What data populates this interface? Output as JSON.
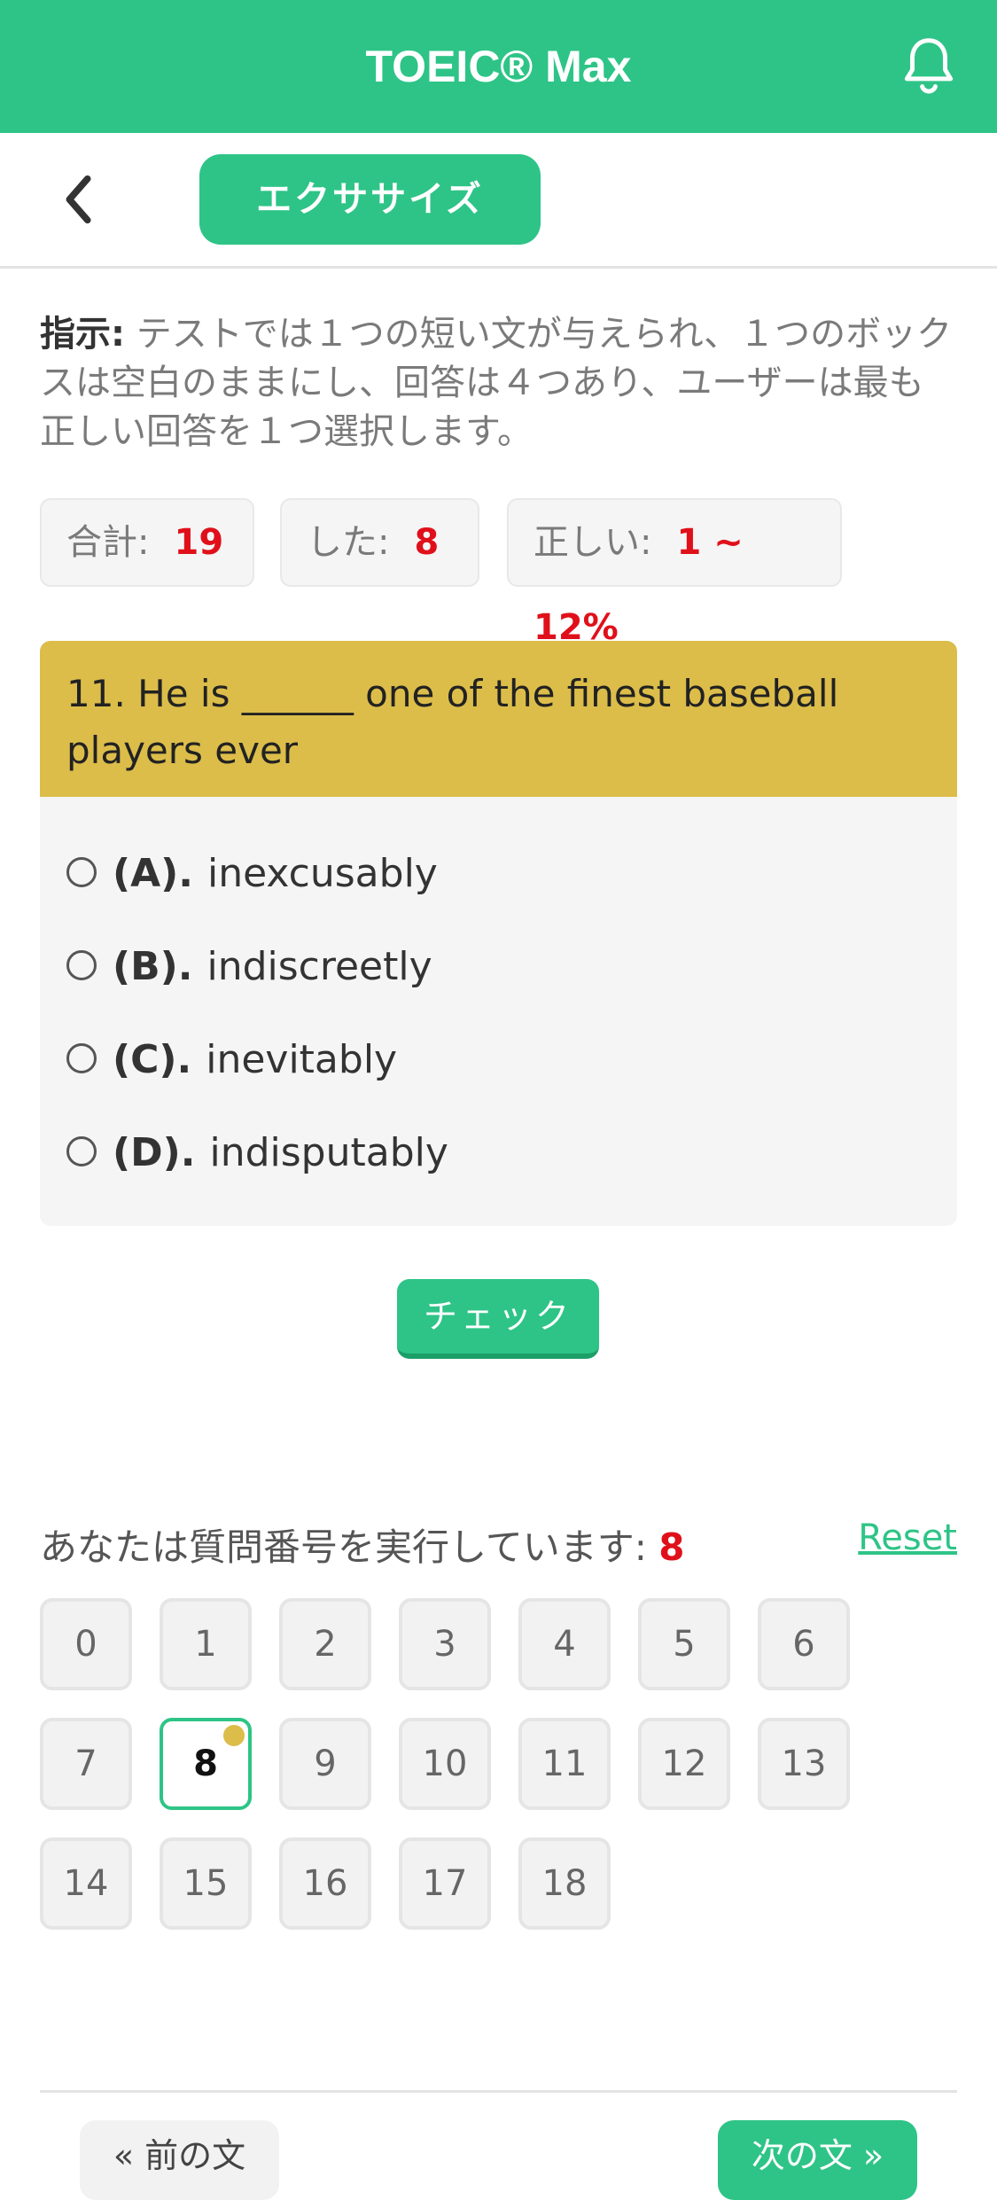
{
  "app": {
    "title": "TOEIC® Max",
    "bell_icon": "bell-icon"
  },
  "subnav": {
    "back_icon": "chevron-left-icon",
    "tab_label": "エクササイズ"
  },
  "instructions": {
    "label": "指示:",
    "text": " テストでは１つの短い文が与えられ、１つのボックスは空白のままにし、回答は４つあり、ユーザーは最も正しい回答を１つ選択します。"
  },
  "stats": {
    "total_label": "合計:",
    "total_value": "19",
    "done_label": "した:",
    "done_value": "8",
    "correct_label": "正しい:",
    "correct_value": "1 ~ 12%"
  },
  "question": {
    "text": "11. He is ______ one of the finest baseball players ever",
    "options": [
      {
        "letter": "(A).",
        "text": "inexcusably"
      },
      {
        "letter": "(B).",
        "text": "indiscreetly"
      },
      {
        "letter": "(C).",
        "text": "inevitably"
      },
      {
        "letter": "(D).",
        "text": "indisputably"
      }
    ],
    "check_label": "チェック"
  },
  "progress": {
    "label": "あなたは質問番号を実行しています: ",
    "current": "8",
    "reset_label": "Reset"
  },
  "question_grid": [
    "0",
    "1",
    "2",
    "3",
    "4",
    "5",
    "6",
    "7",
    "8",
    "9",
    "10",
    "11",
    "12",
    "13",
    "14",
    "15",
    "16",
    "17",
    "18"
  ],
  "footer": {
    "prev_label": "« 前の文",
    "next_label": "次の文 »"
  },
  "colors": {
    "brand": "#2ec487",
    "question_header": "#dcbd4a",
    "highlight_red": "#e0101a"
  }
}
